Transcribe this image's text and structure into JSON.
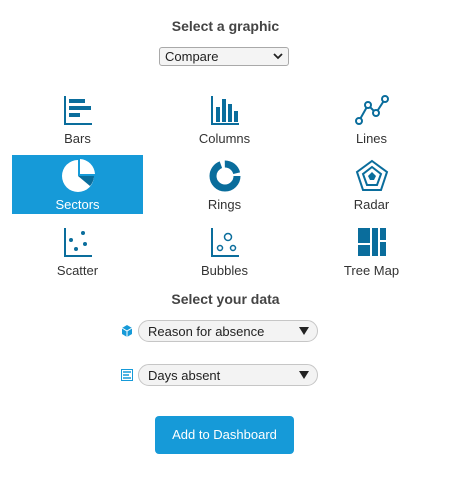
{
  "graphic_heading": "Select a graphic",
  "graphic_select": {
    "value": "Compare"
  },
  "chart_types": [
    {
      "label": "Bars",
      "icon": "bars-chart-icon",
      "selected": false
    },
    {
      "label": "Columns",
      "icon": "columns-chart-icon",
      "selected": false
    },
    {
      "label": "Lines",
      "icon": "lines-chart-icon",
      "selected": false
    },
    {
      "label": "Sectors",
      "icon": "sectors-chart-icon",
      "selected": true
    },
    {
      "label": "Rings",
      "icon": "rings-chart-icon",
      "selected": false
    },
    {
      "label": "Radar",
      "icon": "radar-chart-icon",
      "selected": false
    },
    {
      "label": "Scatter",
      "icon": "scatter-chart-icon",
      "selected": false
    },
    {
      "label": "Bubbles",
      "icon": "bubbles-chart-icon",
      "selected": false
    },
    {
      "label": "Tree Map",
      "icon": "treemap-chart-icon",
      "selected": false
    }
  ],
  "data_heading": "Select your data",
  "dimension_field": {
    "value": "Reason for absence",
    "icon": "cube-icon"
  },
  "measure_field": {
    "value": "Days absent",
    "icon": "measure-icon"
  },
  "add_button": "Add to Dashboard",
  "colors": {
    "accent": "#169ad8",
    "icon": "#0a6d9c"
  }
}
